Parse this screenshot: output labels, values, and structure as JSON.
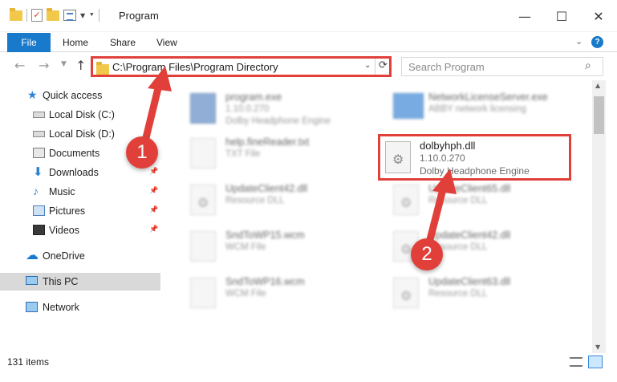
{
  "window": {
    "title": "Program",
    "controls": {
      "minimize": "—",
      "maximize": "☐",
      "close": "✕"
    }
  },
  "ribbon": {
    "tabs": {
      "file": "File",
      "home": "Home",
      "share": "Share",
      "view": "View"
    },
    "help": "?"
  },
  "nav": {
    "address": "C:\\Program Files\\Program Directory",
    "search_placeholder": "Search Program"
  },
  "sidebar": {
    "items": [
      {
        "label": "Quick access",
        "icon": "star-icon"
      },
      {
        "label": "Local Disk (C:)",
        "icon": "disk-icon"
      },
      {
        "label": "Local Disk (D:)",
        "icon": "disk-icon"
      },
      {
        "label": "Documents",
        "icon": "documents-icon"
      },
      {
        "label": "Downloads",
        "icon": "download-icon"
      },
      {
        "label": "Music",
        "icon": "music-icon"
      },
      {
        "label": "Pictures",
        "icon": "pictures-icon"
      },
      {
        "label": "Videos",
        "icon": "videos-icon"
      },
      {
        "label": "OneDrive",
        "icon": "cloud-icon"
      },
      {
        "label": "This PC",
        "icon": "computer-icon"
      },
      {
        "label": "Network",
        "icon": "network-icon"
      }
    ]
  },
  "files": [
    {
      "name": "program.exe",
      "line1": "1.10.0.270",
      "line2": "Dolby Headphone Engine"
    },
    {
      "name": "NetworkLicenseServer.exe",
      "line1": "ABBY network licensing",
      "line2": ""
    },
    {
      "name": "help.fineReader.txt",
      "line1": "TXT File",
      "line2": ""
    },
    {
      "name": "dolbyhph.dll",
      "line1": "1.10.0.270",
      "line2": "Dolby Headphone Engine"
    },
    {
      "name": "UpdateClient42.dll",
      "line1": "Resource DLL",
      "line2": ""
    },
    {
      "name": "UpdateClient65.dll",
      "line1": "Resource DLL",
      "line2": ""
    },
    {
      "name": "SndToWP15.wcm",
      "line1": "WCM File",
      "line2": ""
    },
    {
      "name": "UpdateClient42.dll",
      "line1": "Resource DLL",
      "line2": ""
    },
    {
      "name": "SndToWP16.wcm",
      "line1": "WCM File",
      "line2": ""
    },
    {
      "name": "UpdateClient63.dll",
      "line1": "Resource DLL",
      "line2": ""
    }
  ],
  "status": {
    "item_count": "131 items"
  },
  "annotations": {
    "step1": "1",
    "step2": "2",
    "color": "#e1403a"
  },
  "colors": {
    "accent": "#1979ca",
    "highlight": "#e1403a"
  }
}
